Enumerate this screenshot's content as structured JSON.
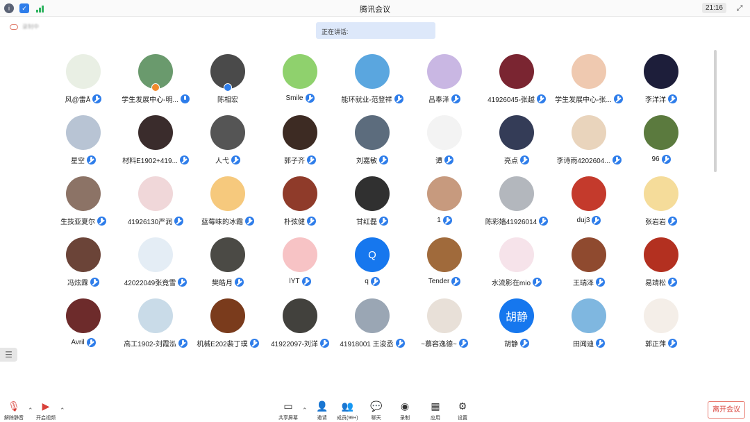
{
  "titlebar": {
    "title": "腾讯会议",
    "clock": "21:16"
  },
  "recording": {
    "label": "录制中"
  },
  "speaking": {
    "label": "正在讲话:"
  },
  "participants": [
    {
      "name": "风@雷Å",
      "color": "#e9efe4",
      "host": false
    },
    {
      "name": "学生发展中心-明...",
      "color": "#6a9a6d",
      "badge": "orange",
      "mic": "unmuted"
    },
    {
      "name": "陈相宏",
      "color": "#4a4a4a",
      "badge": "blue",
      "nomic": true
    },
    {
      "name": "Smile",
      "color": "#8fd16d"
    },
    {
      "name": "能环就业-范登祥",
      "color": "#5aa6df"
    },
    {
      "name": "吕奉泽",
      "color": "#c9b7e3"
    },
    {
      "name": "41926045-张越",
      "color": "#7a2531"
    },
    {
      "name": "学生发展中心-张...",
      "color": "#efc9b0"
    },
    {
      "name": "李洋洋",
      "color": "#1d1e3a"
    },
    {
      "name": "星空",
      "color": "#b8c4d4"
    },
    {
      "name": "材料E1902+419...",
      "color": "#3a2c2c"
    },
    {
      "name": "人弋",
      "color": "#555555"
    },
    {
      "name": "郭子齐",
      "color": "#3d2b23"
    },
    {
      "name": "刘嘉敏",
      "color": "#5c6c7d"
    },
    {
      "name": "谭",
      "color": "#f3f3f3"
    },
    {
      "name": "亮点",
      "color": "#343c57"
    },
    {
      "name": "李诗雨4202604...",
      "color": "#e9d4bc"
    },
    {
      "name": "96",
      "color": "#5b7a3e"
    },
    {
      "name": "生技亚夏尔",
      "color": "#8c7366"
    },
    {
      "name": "41926130严润",
      "color": "#f0d7d9"
    },
    {
      "name": "蓝莓味的冰霜",
      "color": "#f6c97d"
    },
    {
      "name": "朴弦健",
      "color": "#8f3b2a"
    },
    {
      "name": "甘红磊",
      "color": "#303030"
    },
    {
      "name": "1",
      "color": "#c79a7e"
    },
    {
      "name": "陈彩嫱41926014",
      "color": "#b3b7bd"
    },
    {
      "name": "duj3",
      "color": "#c43a2c"
    },
    {
      "name": "张岩岩",
      "color": "#f5dc9a"
    },
    {
      "name": "冯炫霖",
      "color": "#6b4438"
    },
    {
      "name": "42022049张竟雪",
      "color": "#e4edf5"
    },
    {
      "name": "樊皓月",
      "color": "#4b4a45"
    },
    {
      "name": "lYT",
      "color": "#f7c3c5"
    },
    {
      "name": "q",
      "color": "#1677ee",
      "letter": "Q"
    },
    {
      "name": "Tender",
      "color": "#a06a3b"
    },
    {
      "name": "水流影在mio",
      "color": "#f6e3ea"
    },
    {
      "name": "王瑞泽",
      "color": "#8f4a2f"
    },
    {
      "name": "易靖松",
      "color": "#b33020"
    },
    {
      "name": "Avril",
      "color": "#6d2b2b"
    },
    {
      "name": "高工1902-刘霞泓",
      "color": "#c9dbe8"
    },
    {
      "name": "机械E202裴丁璞",
      "color": "#7a3b1c"
    },
    {
      "name": "41922097-刘洋",
      "color": "#42413d"
    },
    {
      "name": "41918001 王浚丞",
      "color": "#9aa6b4"
    },
    {
      "name": "~慕容逸德~",
      "color": "#e8e0d8"
    },
    {
      "name": "胡静",
      "color": "#1677ee",
      "letter": "胡静"
    },
    {
      "name": "田闻迪",
      "color": "#7fb7e0"
    },
    {
      "name": "郭正萍",
      "color": "#f4eee8"
    }
  ],
  "toolbar": {
    "unmute": "解除静音",
    "video": "开启视频",
    "share": "共享屏幕",
    "invite": "邀请",
    "members": "成员(99+)",
    "chat": "聊天",
    "record": "录制",
    "apps": "应用",
    "settings": "设置",
    "leave": "离开会议"
  }
}
